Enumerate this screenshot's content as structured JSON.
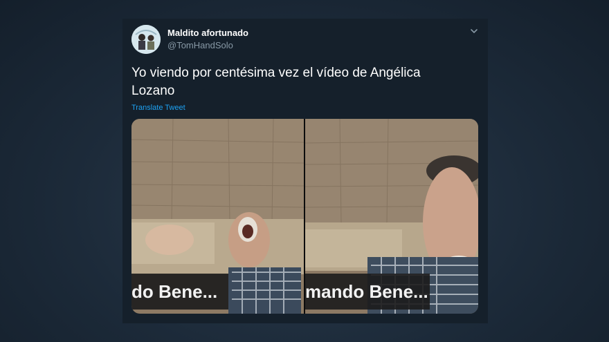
{
  "tweet": {
    "display_name": "Maldito afortunado",
    "handle": "@TomHandSolo",
    "text": "Yo viendo por centésima vez el vídeo de Angélica Lozano",
    "translate_label": "Translate Tweet"
  },
  "media": {
    "left_caption": "do Bene...",
    "right_caption": "mando Bene..."
  },
  "icons": {
    "menu": "chevron-down-icon",
    "avatar": "avatar"
  },
  "colors": {
    "card_background": "#15202b",
    "link": "#1da1f2",
    "secondary_text": "#8899a6"
  }
}
